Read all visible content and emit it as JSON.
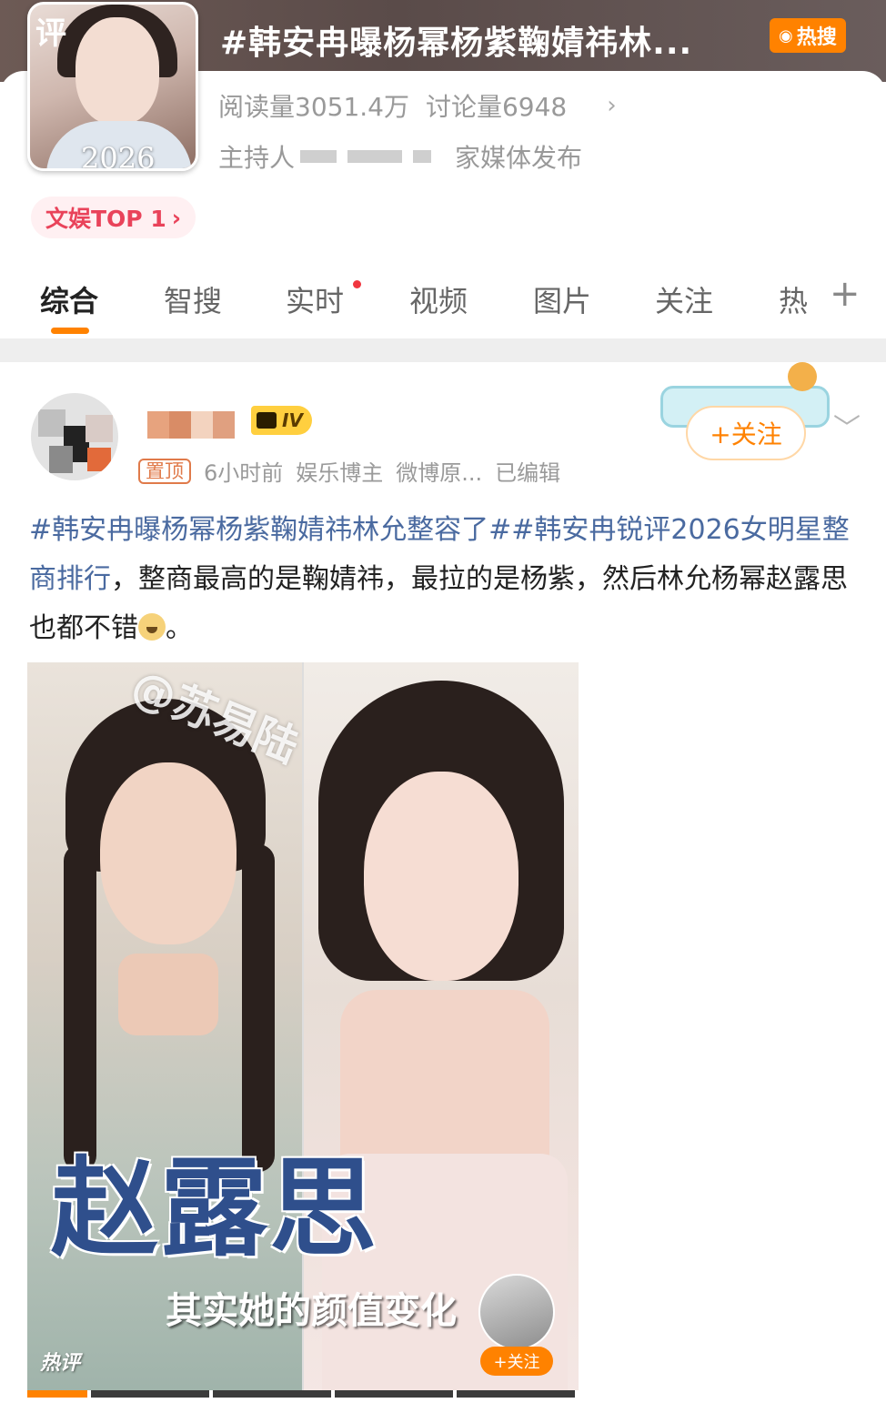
{
  "topic": {
    "title": "#韩安冉曝杨幂杨紫鞠婧祎林...",
    "hot_badge": "热搜",
    "stats": {
      "reads": "阅读量3051.4万",
      "discussions": "讨论量6948"
    },
    "host_prefix": "主持人",
    "host_suffix": "家媒体发布",
    "rank": "文娱TOP 1",
    "cover": {
      "corner_text": "评",
      "year": "2026"
    }
  },
  "tabs": [
    {
      "label": "综合",
      "active": true
    },
    {
      "label": "智搜",
      "active": false
    },
    {
      "label": "实时",
      "active": false,
      "dot": true
    },
    {
      "label": "视频",
      "active": false
    },
    {
      "label": "图片",
      "active": false
    },
    {
      "label": "关注",
      "active": false
    },
    {
      "label": "热",
      "active": false
    }
  ],
  "post": {
    "level": "IV",
    "pin_label": "置顶",
    "time": "6小时前",
    "category": "娱乐博主",
    "source": "微博原...",
    "edited": "已编辑",
    "follow_label": "+关注",
    "text": {
      "tag1": "#韩安冉曝杨幂杨紫鞠婧祎林允整容了#",
      "tag2": "#韩安冉锐评2026女明星整商排行",
      "body": "，整商最高的是鞠婧祎，最拉的是杨紫，然后林允杨幂赵露思也都不错",
      "ending": "。"
    },
    "media": {
      "watermark": "@苏易陆",
      "name_overlay": "赵露思",
      "subtitle": "其实她的颜值变化",
      "hot_mark": "热评",
      "mini_follow": "+关注"
    }
  },
  "colors": {
    "accent": "#ff8200",
    "hashtag": "#4a6aa0",
    "rank": "#e9435a",
    "header_bg": "#5e4f4c"
  }
}
